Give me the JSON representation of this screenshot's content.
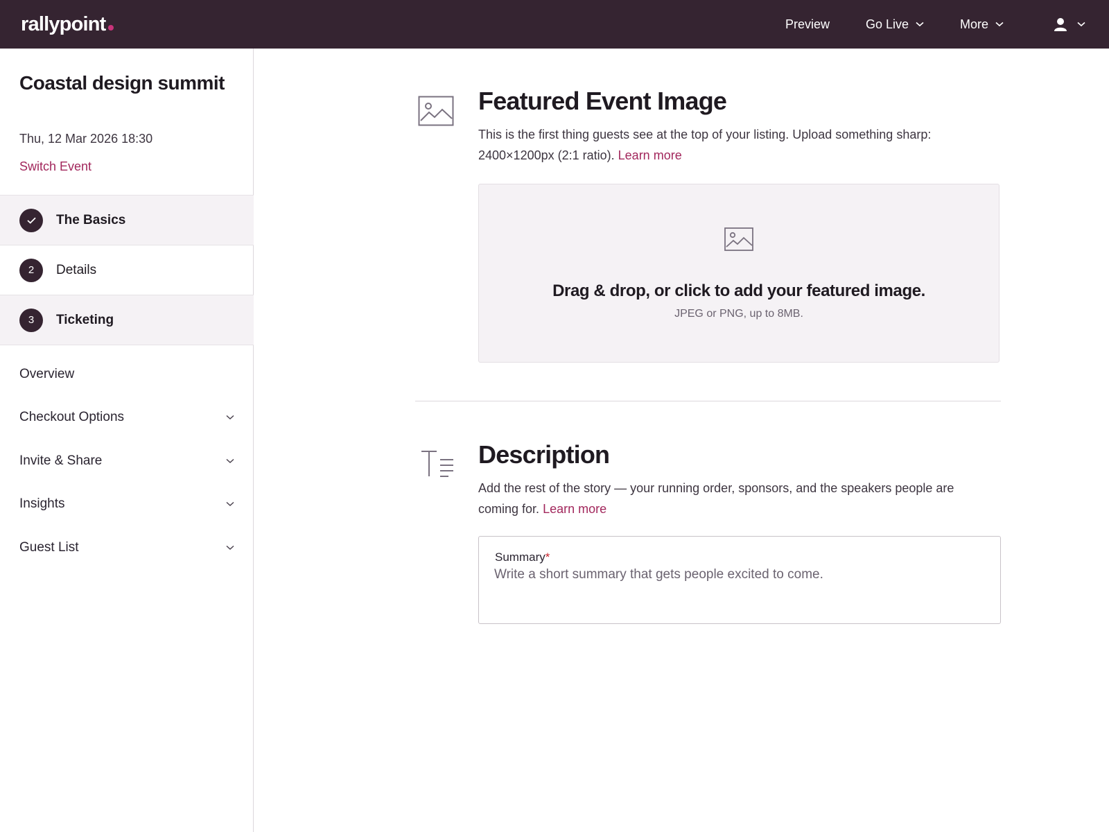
{
  "brand": {
    "name": "rallypoint",
    "accent": "#c8347a",
    "topbar_bg": "#352431",
    "link_color": "#a2275c"
  },
  "topnav": {
    "preview": "Preview",
    "go_live": "Go Live",
    "more": "More",
    "user_icon": "user-icon"
  },
  "sidebar": {
    "event_title": "Coastal design summit",
    "event_date": "Thu, 12 Mar 2026 18:30",
    "switch_event": "Switch Event",
    "steps": [
      {
        "badge": "✓",
        "label": "The Basics",
        "state": "complete"
      },
      {
        "badge": "2",
        "label": "Details",
        "state": "pending"
      },
      {
        "badge": "3",
        "label": "Ticketing",
        "state": "current"
      }
    ],
    "menu": [
      {
        "label": "Overview",
        "expandable": false
      },
      {
        "label": "Checkout Options",
        "expandable": true
      },
      {
        "label": "Invite & Share",
        "expandable": true
      },
      {
        "label": "Insights",
        "expandable": true
      },
      {
        "label": "Guest List",
        "expandable": true
      }
    ]
  },
  "featured_image": {
    "icon": "image-icon",
    "title": "Featured Event Image",
    "description": "This is the first thing guests see at the top of your listing. Upload something sharp: 2400×1200px (2:1 ratio).",
    "learn_more": "Learn more",
    "dropzone_title": "Drag & drop, or click to add your featured image.",
    "dropzone_sub": "JPEG or PNG, up to 8MB."
  },
  "description_section": {
    "icon": "text-format-icon",
    "title": "Description",
    "description": "Add the rest of the story — your running order, sponsors, and the speakers people are coming for.",
    "learn_more": "Learn more",
    "summary_label": "Summary",
    "required_mark": "*",
    "summary_placeholder": "Write a short summary that gets people excited to come."
  }
}
